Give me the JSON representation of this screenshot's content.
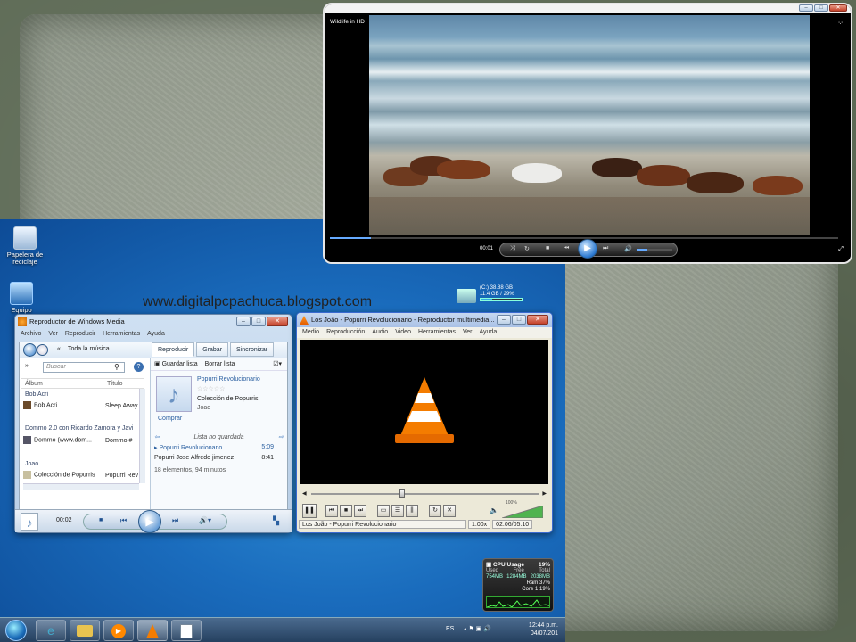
{
  "site_watermark": "www.digitalpcpachuca.blogspot.com",
  "desktop": {
    "icons": [
      {
        "label_line1": "Papelera de",
        "label_line2": "reciclaje"
      },
      {
        "label_line1": "Equipo",
        "label_line2": ""
      }
    ],
    "drive": {
      "name": "(C:) 38.88 GB",
      "usage": "11.4 GB / 29%",
      "percent": 29
    },
    "cpu_gadget": {
      "title": "CPU Usage",
      "value": "19%",
      "used_label": "Used",
      "free_label": "Free",
      "total_label": "Total",
      "used": "754MB",
      "free": "1284MB",
      "total": "2038MB",
      "ram_label": "Ram",
      "ram": "37%",
      "core_label": "Core 1",
      "core": "19%"
    }
  },
  "taskbar": {
    "lang": "ES",
    "time": "12:44 p.m.",
    "date": "04/07/201"
  },
  "wmp": {
    "title": "Reproductor de Windows Media",
    "menu": [
      "Archivo",
      "Ver",
      "Reproducir",
      "Herramientas",
      "Ayuda"
    ],
    "breadcrumb": "Toda la música",
    "tabs": [
      "Reproducir",
      "Grabar",
      "Sincronizar"
    ],
    "search_placeholder": "Buscar",
    "columns": [
      "Álbum",
      "Título"
    ],
    "groups": [
      "Bob Acri",
      "Dommo 2.0 con Ricardo Zamora y Javi",
      "Joao"
    ],
    "rows": [
      {
        "album": "Bob Acri",
        "title": "Sleep Away"
      },
      {
        "album": "Dommo (www.dom...",
        "title": "Dommo #"
      },
      {
        "album": "Colección de Popurris",
        "title": "Popurri Rev"
      }
    ],
    "save_list": "Guardar lista",
    "clear_list": "Borrar lista",
    "now_playing": {
      "title": "Popurri Revolucionario",
      "album": "Colección de Popurris",
      "artist": "Joao",
      "buy": "Comprar"
    },
    "playlist_label": "Lista no guardada",
    "playlist": [
      {
        "title": "Popurri Revolucionario",
        "duration": "5:09"
      },
      {
        "title": "Popurri Jose Alfredo jimenez",
        "duration": "8:41"
      }
    ],
    "summary": "18 elementos, 94 minutos",
    "time": "00:02"
  },
  "vlc": {
    "title": "Los João - Popurri Revolucionario - Reproductor multimedia...",
    "menu": [
      "Medio",
      "Reproducción",
      "Audio",
      "Video",
      "Herramientas",
      "Ver",
      "Ayuda"
    ],
    "volume": "100%",
    "status_title": "Los João - Popurri Revolucionario",
    "speed": "1.00x",
    "time": "02:06/05:10",
    "seek_fraction": 0.4
  },
  "video": {
    "title": "Wildlife in HD",
    "time": "00:01",
    "progress_fraction": 0.08,
    "volume_fraction": 0.3
  }
}
